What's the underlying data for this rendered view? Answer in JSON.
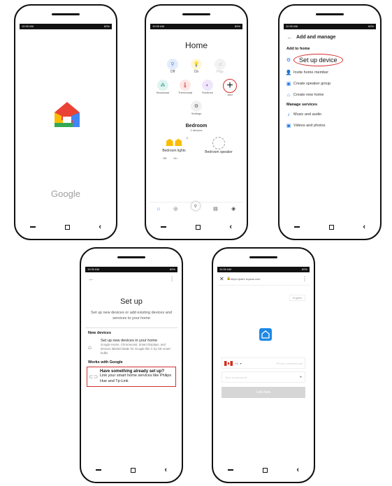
{
  "status": {
    "time": "10:30 AM",
    "battery": "60%"
  },
  "nav": {
    "back": "‹"
  },
  "phone1": {
    "brand": "Google"
  },
  "phone2": {
    "title": "Home",
    "row1": [
      "Off",
      "On",
      "Play"
    ],
    "row2": [
      "Broadcast",
      "Thermostat",
      "Routines",
      "Add"
    ],
    "settings": "Settings",
    "room": "Bedroom",
    "room_sub": "2 devices",
    "lights_label": "Bedroom lights",
    "lights_count": "2",
    "speaker_label": "Bedroom speaker",
    "off": "Off",
    "on": "On"
  },
  "phone3": {
    "title": "Add and manage",
    "sect_add": "Add to home",
    "setup_device": "Set up device",
    "invite": "Invite home member",
    "speaker_group": "Create speaker group",
    "new_home": "Create new home",
    "sect_manage": "Manage services",
    "music": "Music and audio",
    "videos": "Videos and photos"
  },
  "phone4": {
    "title": "Set up",
    "subtitle": "Set up new devices or add existing devices and services to your home",
    "sect_new": "New devices",
    "new_title": "Set up new devices in your home",
    "new_desc": "Google Home, Chromecast, Smart Displays, and devices labeled Made for Google like C by GE smart bulbs",
    "sect_works": "Works with Google",
    "works_title": "Have something already set up?",
    "works_desc": "Link your smart home services like Philips Hue and Tp-Link"
  },
  "phone5": {
    "url": "https://pair1.tuyaus.com",
    "lang": "English",
    "country_code": "+1",
    "phone_placeholder": "Phone number/Email",
    "password_placeholder": "Type in password",
    "link_button": "Link Now"
  },
  "colors": {
    "google_red": "#ea4335",
    "google_yellow": "#fbbc04",
    "google_green": "#34a853",
    "google_blue": "#4285f4",
    "annotation_red": "#d32f2f",
    "tuya_blue": "#1e88e5"
  }
}
